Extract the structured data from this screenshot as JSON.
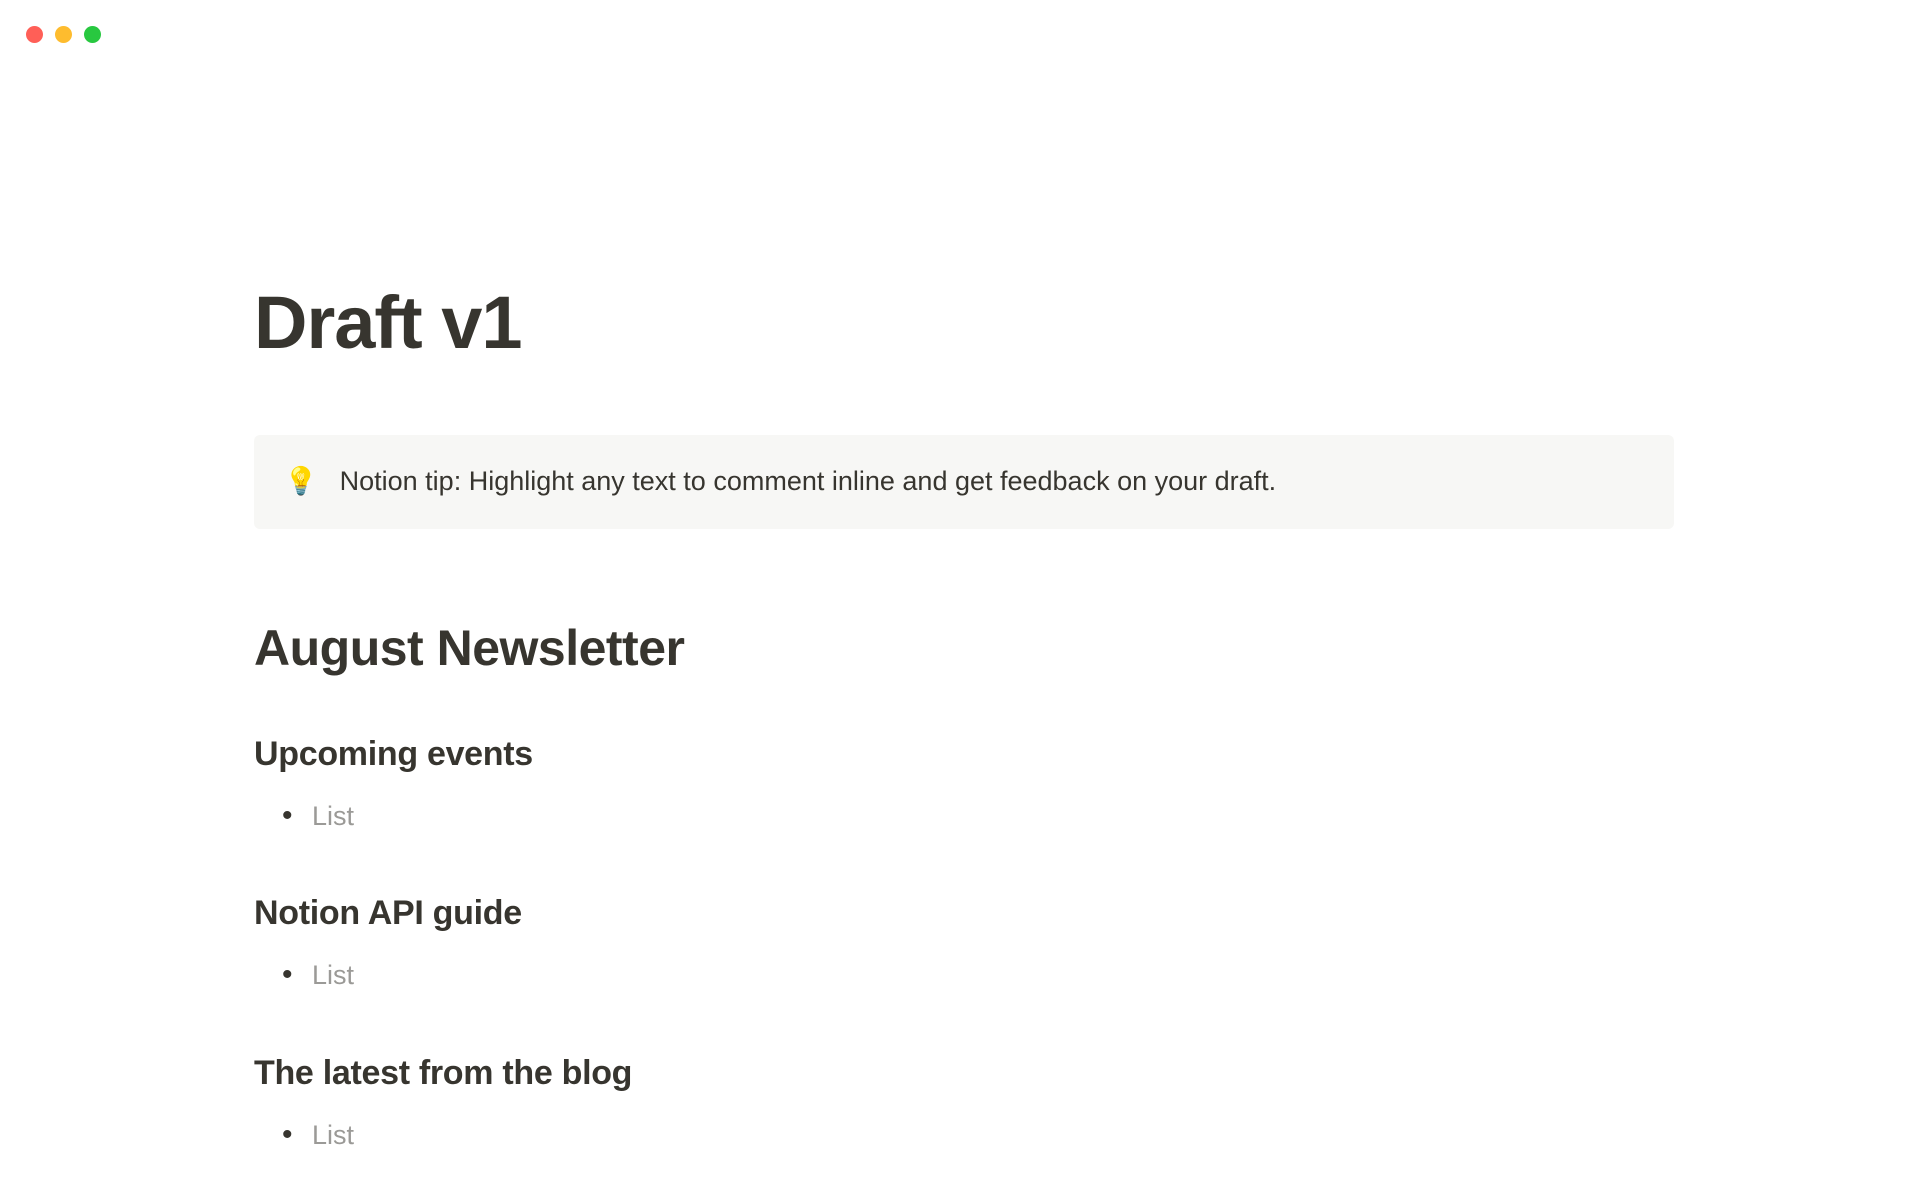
{
  "page": {
    "title": "Draft v1"
  },
  "callout": {
    "icon": "💡",
    "text": "Notion tip: Highlight any text to comment inline and get feedback on your draft."
  },
  "heading1": "August Newsletter",
  "sections": [
    {
      "heading": "Upcoming events",
      "items": [
        "List"
      ]
    },
    {
      "heading": "Notion API guide",
      "items": [
        "List"
      ]
    },
    {
      "heading": "The latest from the blog",
      "items": [
        "List"
      ]
    }
  ]
}
